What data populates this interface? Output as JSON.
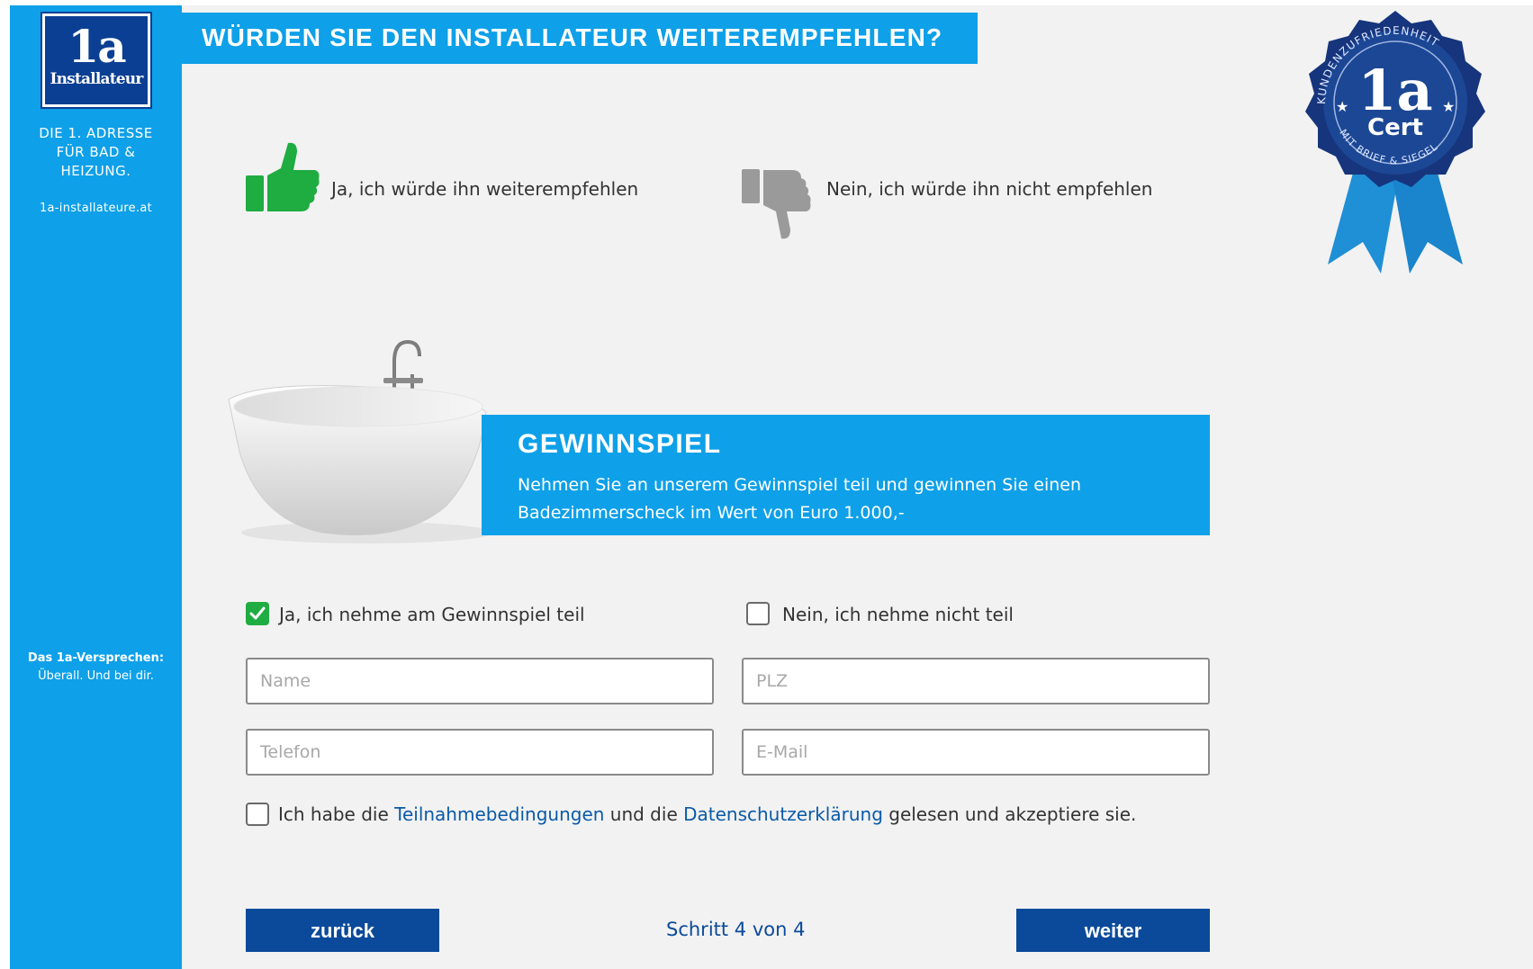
{
  "sidebar": {
    "logo_top": "1a",
    "logo_bottom": "Installateur",
    "tagline": [
      "DIE 1. ADRESSE",
      "FÜR BAD &",
      "HEIZUNG."
    ],
    "url": "1a-installateure.at",
    "promise_title": "Das 1a-Versprechen:",
    "promise_text": "Überall. Und bei dir."
  },
  "header": {
    "title": "WÜRDEN SIE DEN INSTALLATEUR WEITEREMPFEHLEN?"
  },
  "recommend": {
    "yes_label": "Ja, ich würde ihn weiterempfehlen",
    "no_label": "Nein, ich würde ihn nicht empfehlen",
    "selected": "yes"
  },
  "seal": {
    "arc_text": "KUNDENZUFRIEDENHEIT",
    "big": "1a",
    "cert": "Cert",
    "bottom_text": "MIT BRIEF & SIEGEL"
  },
  "contest": {
    "title": "GEWINNSPIEL",
    "text_line1": "Nehmen Sie an unserem Gewinnspiel teil und gewinnen Sie einen",
    "text_line2": "Badezimmerscheck im Wert von Euro 1.000,-",
    "join_label": "Ja, ich nehme am Gewinnspiel teil",
    "decline_label": "Nein, ich nehme nicht teil",
    "join_checked": true
  },
  "form": {
    "name_placeholder": "Name",
    "plz_placeholder": "PLZ",
    "phone_placeholder": "Telefon",
    "email_placeholder": "E-Mail"
  },
  "terms": {
    "prefix": "Ich habe die",
    "link1": "Teilnahmebedingungen",
    "middle": "und die",
    "link2": "Datenschutzerklärung",
    "suffix": "gelesen und akzeptiere sie."
  },
  "nav": {
    "back": "zurück",
    "step": "Schritt 4 von 4",
    "next": "weiter"
  },
  "colors": {
    "brand_blue": "#0ea0e8",
    "dark_blue": "#0b4a9a",
    "green": "#1fac41",
    "grey": "#9a9a9a"
  }
}
